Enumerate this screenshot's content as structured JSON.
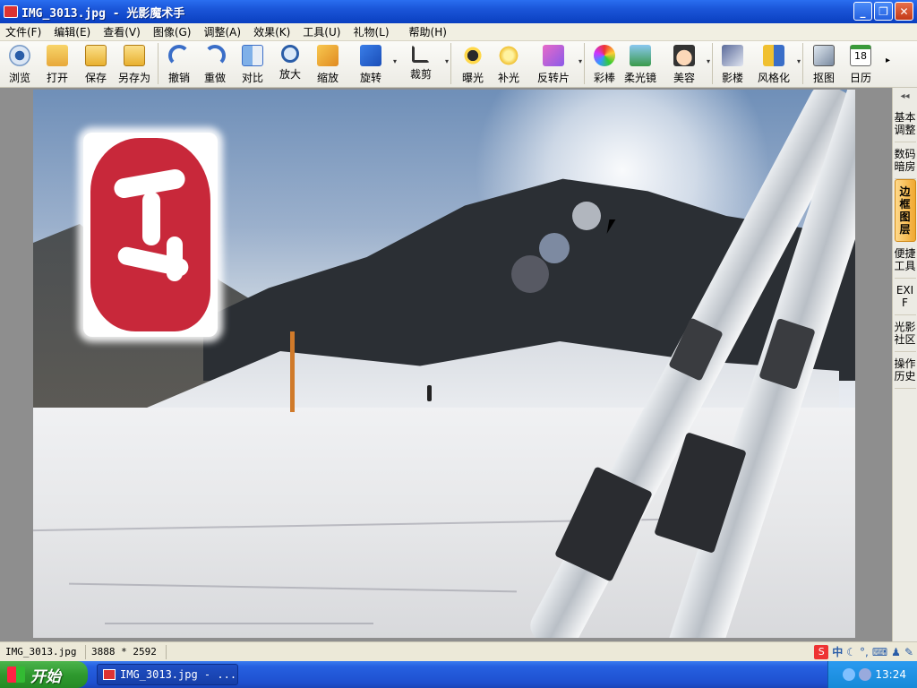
{
  "window": {
    "title": "IMG_3013.jpg - 光影魔术手"
  },
  "menu": [
    {
      "label": "文件(F)"
    },
    {
      "label": "编辑(E)"
    },
    {
      "label": "查看(V)"
    },
    {
      "label": "图像(G)"
    },
    {
      "label": "调整(A)"
    },
    {
      "label": "效果(K)"
    },
    {
      "label": "工具(U)"
    },
    {
      "label": "礼物(L)"
    },
    {
      "label": "帮助(H)"
    }
  ],
  "toolbar": {
    "browse": "浏览",
    "open": "打开",
    "save": "保存",
    "save_as": "另存为",
    "undo": "撤销",
    "redo": "重做",
    "compare": "对比",
    "zoom_in": "放大",
    "resize": "缩放",
    "rotate": "旋转",
    "crop": "裁剪",
    "exposure": "曝光",
    "fill_light": "补光",
    "invert": "反转片",
    "color_pen": "彩棒",
    "soft_lens": "柔光镜",
    "beauty": "美容",
    "shadow": "影楼",
    "stylize": "风格化",
    "cutout": "抠图",
    "calendar": "日历",
    "calendar_day": "18"
  },
  "side_panel": {
    "collapse": "◂◂",
    "tabs": [
      "基本调整",
      "数码暗房",
      "边框图层",
      "便捷工具",
      "EXIF",
      "光影社区",
      "操作历史"
    ],
    "active_tab": "边框图层"
  },
  "statusbar": {
    "filename": "IMG_3013.jpg",
    "dimensions": "3888 * 2592"
  },
  "ime": {
    "logo": "S",
    "mode": "中"
  },
  "taskbar": {
    "start_label": "开始",
    "task_label": "IMG_3013.jpg - ...",
    "clock": "13:24"
  },
  "colors": {
    "titlebar": "#1a55d8",
    "start": "#2f9a2f",
    "seal": "#c8283a",
    "active_tab": "#f0a830"
  }
}
